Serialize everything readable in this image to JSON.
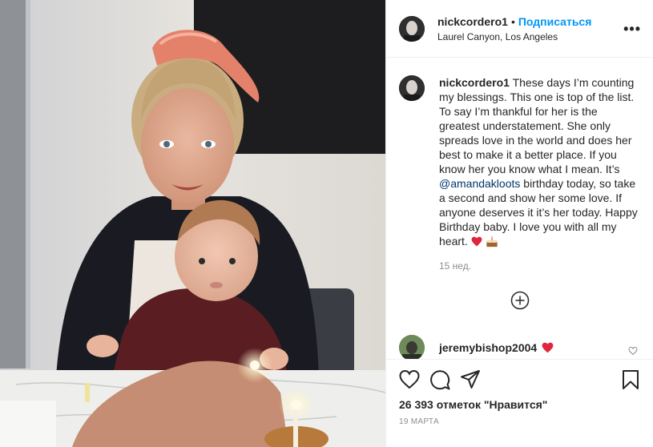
{
  "header": {
    "username": "nickcordero1",
    "separator": "•",
    "follow_label": "Подписаться",
    "location": "Laurel Canyon, Los Angeles",
    "more_label": "•••"
  },
  "caption": {
    "username": "nickcordero1",
    "text_before": " These days I’m counting my blessings. This one is top of the list. To say I’m thankful for her is the greatest understatement. She only spreads love in the world and does her best to make it a better place. If you know her you know what I mean. It’s ",
    "mention": "@amandakloots",
    "text_after": " birthday today, so take a second and show her some love. If anyone deserves it it’s her today. Happy Birthday baby. I love you with all my heart. ",
    "time": "15 нед."
  },
  "comments": [
    {
      "username": "jeremybishop2004",
      "icon": "red-heart-icon"
    }
  ],
  "actions": {
    "like_icon": "heart-outline-icon",
    "comment_icon": "comment-icon",
    "share_icon": "paper-plane-icon",
    "save_icon": "bookmark-icon"
  },
  "likes": "26 393 отметок \"Нравится\"",
  "date": "19 марта",
  "colors": {
    "accent": "#0095f6",
    "text": "#262626",
    "muted": "#8e8e8e",
    "mention": "#00376b",
    "heart": "#ed4956"
  }
}
